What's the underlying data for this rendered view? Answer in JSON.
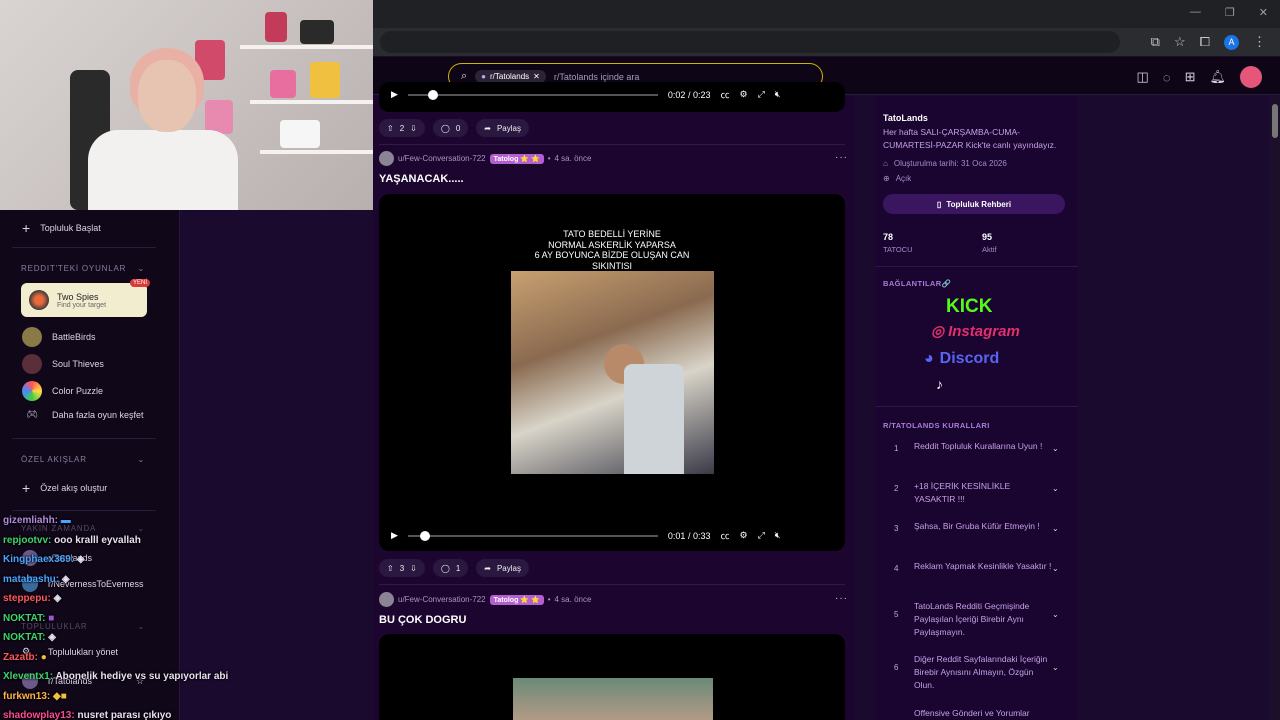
{
  "search": {
    "chip": "r/Tatolands",
    "placeholder": "r/Tatolands içinde ara"
  },
  "sidebar": {
    "start_community": "Topluluk Başlat",
    "games_section": "REDDIT'TEKİ OYUNLAR",
    "featured_game": {
      "name": "Two Spies",
      "tagline": "Find your target",
      "badge": "YENİ"
    },
    "games": [
      "BattleBirds",
      "Soul Thieves",
      "Color Puzzle"
    ],
    "discover_more": "Daha fazla oyun keşfet",
    "custom_section": "ÖZEL AKIŞLAR",
    "create_feed": "Özel akış oluştur",
    "recent_section": "YAKIN ZAMANDA",
    "recent": [
      "r/Tatolands",
      "r/NevernessToEverness"
    ],
    "communities_section": "TOPLULUKLAR",
    "manage_communities": "Toplulukları yönet",
    "community_item": "r/Tatolands"
  },
  "chat": [
    {
      "user": "gizemliahh:",
      "msg": "",
      "color": "#b18be0"
    },
    {
      "user": "repjootvv:",
      "msg": "ooo kralll eyvallah",
      "color": "#3fd46b"
    },
    {
      "user": "Kingphaex369:",
      "msg": "",
      "color": "#4aa3ff"
    },
    {
      "user": "matabashu:",
      "msg": "",
      "color": "#4aa3ff"
    },
    {
      "user": "steppepu:",
      "msg": "",
      "color": "#ff5a5a"
    },
    {
      "user": "NOKTAT:",
      "msg": "",
      "color": "#3fd46b"
    },
    {
      "user": "NOKTAT:",
      "msg": "",
      "color": "#3fd46b"
    },
    {
      "user": "Zazatb:",
      "msg": "",
      "color": "#ff5a5a"
    },
    {
      "user": "Xleventx1:",
      "msg": "Abonelik hediye vs su yapıyorlar abi",
      "color": "#3fd46b"
    },
    {
      "user": "furkwn13:",
      "msg": "",
      "color": "#ffb347"
    },
    {
      "user": "shadowplay13:",
      "msg": "nusret parası çıkıyo",
      "color": "#ff4d8d"
    }
  ],
  "feed": {
    "top_video_time": "0:02 / 0:23",
    "top_actions": {
      "votes": "2",
      "comments": "0",
      "share": "Paylaş"
    },
    "posts": [
      {
        "user": "u/Few-Conversation-722",
        "flair": "Tatolog ⭐ ⭐",
        "time": "4 sa. önce",
        "title": "YAŞANACAK.....",
        "caption": "TATO BEDELLİ YERİNE\nNORMAL ASKERLİK YAPARSA\n6 AY BOYUNCA BİZDE OLUŞAN CAN\nSIKINTISI",
        "video_time": "0:01 / 0:33",
        "progress": 0.05,
        "votes": "3",
        "comments": "1",
        "share": "Paylaş"
      },
      {
        "user": "u/Few-Conversation-722",
        "flair": "Tatolog ⭐ ⭐",
        "time": "4 sa. önce",
        "title": "BU ÇOK DOGRU"
      }
    ]
  },
  "community": {
    "name": "TatoLands",
    "description": "Her hafta SALI-ÇARŞAMBA-CUMA-CUMARTESİ-PAZAR Kick'te canlı yayındayız.",
    "created": "Oluşturulma tarihi: 31 Oca 2026",
    "visibility": "Açık",
    "guide_button": "Topluluk Rehberi",
    "stats": [
      {
        "value": "78",
        "label": "TATOCU"
      },
      {
        "value": "95",
        "label": "Aktif"
      }
    ],
    "links_title": "BAĞLANTILAR🔗",
    "links": [
      "KICK",
      "Instagram",
      "Discord"
    ],
    "rules_title": "R/TATOLANDS KURALLARI",
    "rules": [
      "Reddit Topluluk Kurallarına Uyun !",
      "+18 İÇERİK KESİNLİKLE YASAKTIR !!!",
      "Şahsa, Bir Gruba Küfür Etmeyin !",
      "Reklam Yapmak Kesinlikle Yasaktır !",
      "TatoLands Redditi Geçmişinde Paylaşılan İçeriği Birebir Aynı Paylaşmayın.",
      "Diğer Reddit Sayfalarındaki İçeriğin Birebir Aynısını Almayın, Özgün Olun.",
      "Offensive Gönderi ve Yorumlar"
    ]
  }
}
